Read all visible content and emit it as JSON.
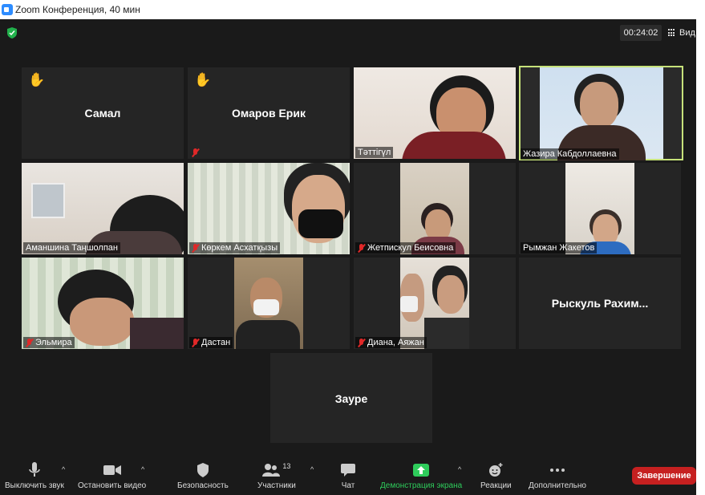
{
  "window": {
    "title": "Zoom Конференция, 40 мин"
  },
  "header": {
    "timer": "00:24:02",
    "view_label": "Вид"
  },
  "tiles": {
    "samal": {
      "name": "Самал",
      "hand_raised": true
    },
    "erik": {
      "name": "Омаров Ерик",
      "hand_raised": true,
      "muted": true
    },
    "tattigul": {
      "name": "Тәттігүл"
    },
    "zhazira": {
      "name": "Жазира Кабдоллаевна",
      "active_speaker": true
    },
    "amanshina": {
      "name": "Аманшина Таңшолпан"
    },
    "korkem": {
      "name": "Көркем Асхатқызы",
      "muted": true
    },
    "zhetpiskul": {
      "name": "Жетпискул Беисовна",
      "muted": true
    },
    "rymzhan": {
      "name": "Рымжан Жакетов"
    },
    "elmira": {
      "name": "Эльмира",
      "muted": true
    },
    "dastan": {
      "name": "Дастан",
      "muted": true
    },
    "diana": {
      "name": "Диана, Аяжан",
      "muted": true
    },
    "ryskul": {
      "name": "Рыскуль  Рахим..."
    },
    "zaure": {
      "name": "Зауре"
    }
  },
  "toolbar": {
    "mute": "Выключить звук",
    "video": "Остановить видео",
    "security": "Безопасность",
    "participants": "Участники",
    "participants_count": "13",
    "chat": "Чат",
    "share": "Демонстрация экрана",
    "reactions": "Реакции",
    "more": "Дополнительно",
    "end": "Завершение"
  },
  "colors": {
    "accent_green": "#2ecc5b",
    "end_red": "#c62020",
    "speaker_outline": "#c6e27a"
  }
}
